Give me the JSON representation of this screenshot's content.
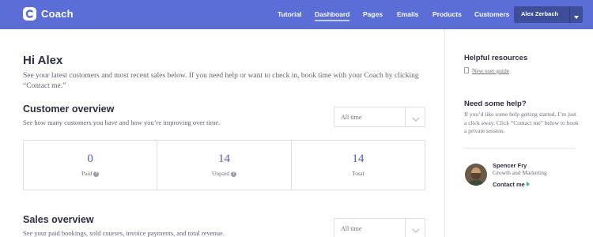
{
  "brand": {
    "name": "Coach"
  },
  "nav": {
    "links": [
      {
        "label": "Tutorial"
      },
      {
        "label": "Dashboard",
        "active": true
      },
      {
        "label": "Pages"
      },
      {
        "label": "Emails"
      },
      {
        "label": "Products"
      },
      {
        "label": "Customers"
      }
    ],
    "user_name": "Alex Zerbach"
  },
  "main": {
    "greeting": "Hi Alex",
    "intro": "See your latest customers and most recent sales below. If you need help or want to check in, book time with your Coach by clicking “Contact me.”",
    "customer_overview": {
      "title": "Customer overview",
      "description": "See how many customers you have and how you’re improving over time.",
      "filter": "All time",
      "stats": [
        {
          "value": "0",
          "label": "Paid",
          "info": "?"
        },
        {
          "value": "14",
          "label": "Unpaid",
          "info": "?"
        },
        {
          "value": "14",
          "label": "Total"
        }
      ]
    },
    "sales_overview": {
      "title": "Sales overview",
      "description": "See your paid bookings, sold courses, invoice payments, and total revenue.",
      "filter": "All time"
    }
  },
  "sidebar": {
    "resources_title": "Helpful resources",
    "resources_link": "New user guide",
    "help_title": "Need some help?",
    "help_text": "If you’d like some help getting started, I’m just a click away. Click “Contact me” below to book a private session.",
    "coach_name": "Spencer Fry",
    "coach_role": "Growth and Marketing",
    "contact_label": "Contact me"
  },
  "colors": {
    "topbar": "#5b6ed8",
    "accent": "#4a5cc4",
    "contact_arrow": "#3cb878"
  },
  "icons": [
    "coach-logo-icon",
    "chevron-down-icon",
    "info-icon",
    "document-icon",
    "arrow-right-icon"
  ]
}
